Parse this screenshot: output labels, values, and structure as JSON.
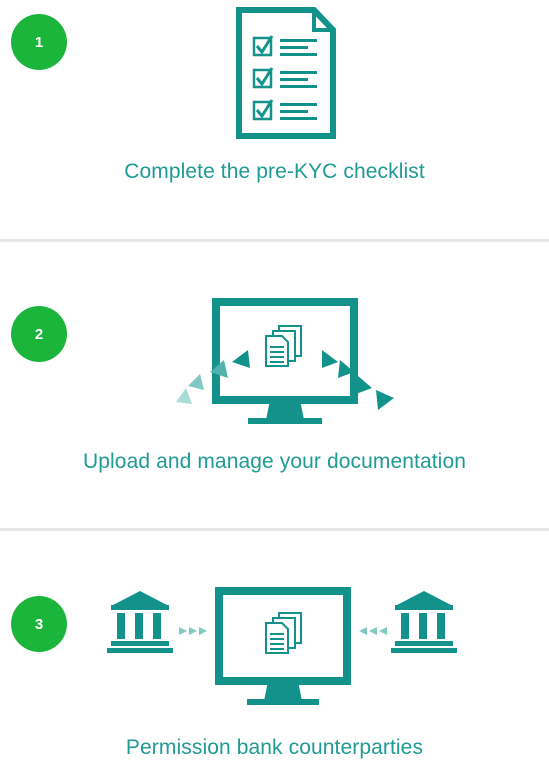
{
  "steps": [
    {
      "number": "1",
      "caption": "Complete the pre-KYC checklist",
      "illustration": "checklist-document-icon"
    },
    {
      "number": "2",
      "caption": "Upload and manage your documentation",
      "illustration": "monitor-upload-icon"
    },
    {
      "number": "3",
      "caption": "Permission bank counterparties",
      "illustration": "bank-monitor-bank-icon"
    }
  ],
  "colors": {
    "teal": "#13928b",
    "teal_light": "#a8dcd7",
    "green_badge": "#1bb53c",
    "caption_text": "#1f9a94",
    "divider": "#e8e8e8"
  }
}
